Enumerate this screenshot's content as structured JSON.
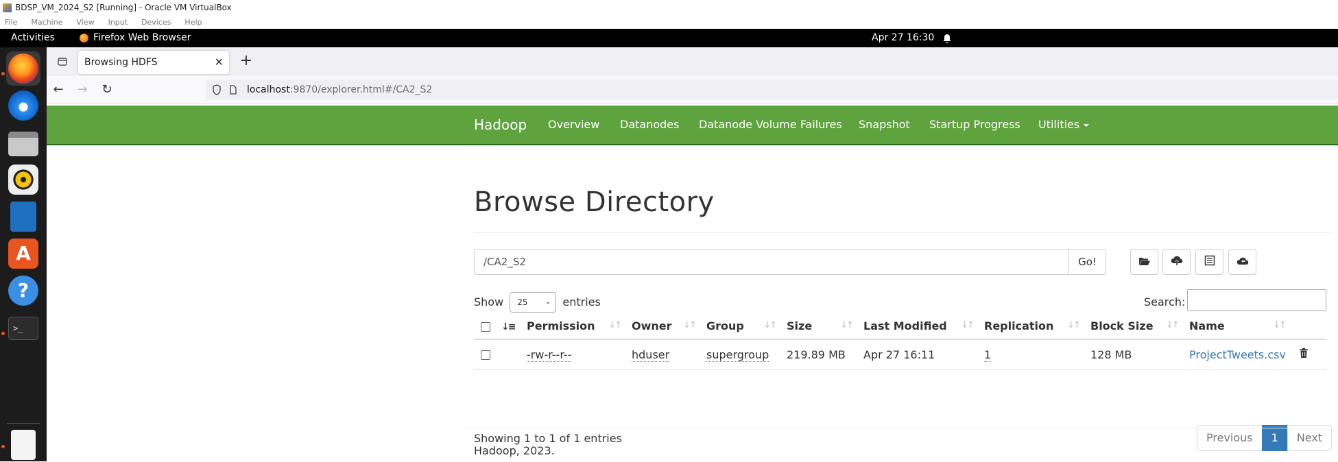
{
  "vbox": {
    "title": "BDSP_VM_2024_S2 [Running] - Oracle VM VirtualBox",
    "menu": [
      "File",
      "Machine",
      "View",
      "Input",
      "Devices",
      "Help"
    ]
  },
  "gnome": {
    "activities": "Activities",
    "app_name": "Firefox Web Browser",
    "clock": "Apr 27  16:30"
  },
  "dock": [
    "firefox-icon",
    "thunderbird-icon",
    "files-icon",
    "rhythmbox-icon",
    "libreoffice-writer-icon",
    "app-center-icon",
    "help-icon",
    "terminal-icon",
    "text-editor-icon"
  ],
  "browser": {
    "tab_title": "Browsing HDFS",
    "url_host": "localhost",
    "url_rest": ":9870/explorer.html#/CA2_S2"
  },
  "hadoop_nav": {
    "brand": "Hadoop",
    "items": [
      "Overview",
      "Datanodes",
      "Datanode Volume Failures",
      "Snapshot",
      "Startup Progress",
      "Utilities"
    ]
  },
  "main": {
    "heading": "Browse Directory",
    "path_value": "/CA2_S2",
    "go_label": "Go!",
    "show_label": "Show",
    "entries_value": "25",
    "entries_label": "entries",
    "search_label": "Search:",
    "columns": [
      "Permission",
      "Owner",
      "Group",
      "Size",
      "Last Modified",
      "Replication",
      "Block Size",
      "Name"
    ],
    "rows": [
      {
        "permission": "-rw-r--r--",
        "owner": "hduser",
        "group": "supergroup",
        "size": "219.89 MB",
        "last_modified": "Apr 27 16:11",
        "replication": "1",
        "block_size": "128 MB",
        "name": "ProjectTweets.csv"
      }
    ],
    "info": "Showing 1 to 1 of 1 entries",
    "pager": {
      "prev": "Previous",
      "current": "1",
      "next": "Next"
    },
    "footer": "Hadoop, 2023."
  },
  "colors": {
    "hadoop_green": "#5fa33e",
    "link_blue": "#337ab7"
  }
}
